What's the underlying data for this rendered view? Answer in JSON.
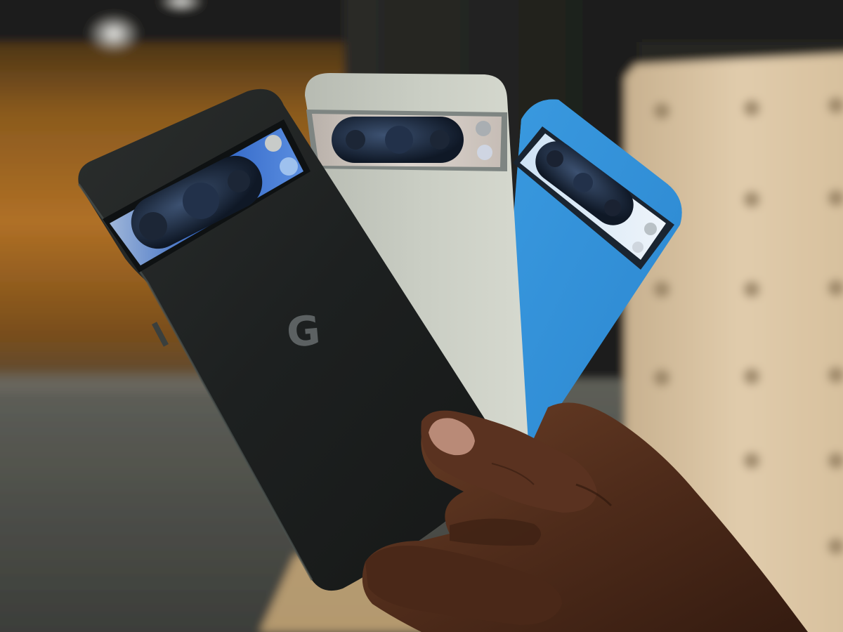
{
  "photo": {
    "subject": "three-phones-in-hand",
    "phones": [
      {
        "finish": "black",
        "color": "#1f2221"
      },
      {
        "finish": "sage",
        "color": "#c4c8bf"
      },
      {
        "finish": "blue",
        "color": "#3b9be0"
      }
    ],
    "logo_letter": "G",
    "colors": {
      "wall_wood": "#a86a22",
      "floor": "#4a4d49",
      "pegboard": "#d8c3a3",
      "skin": "#4a2a1a"
    }
  }
}
